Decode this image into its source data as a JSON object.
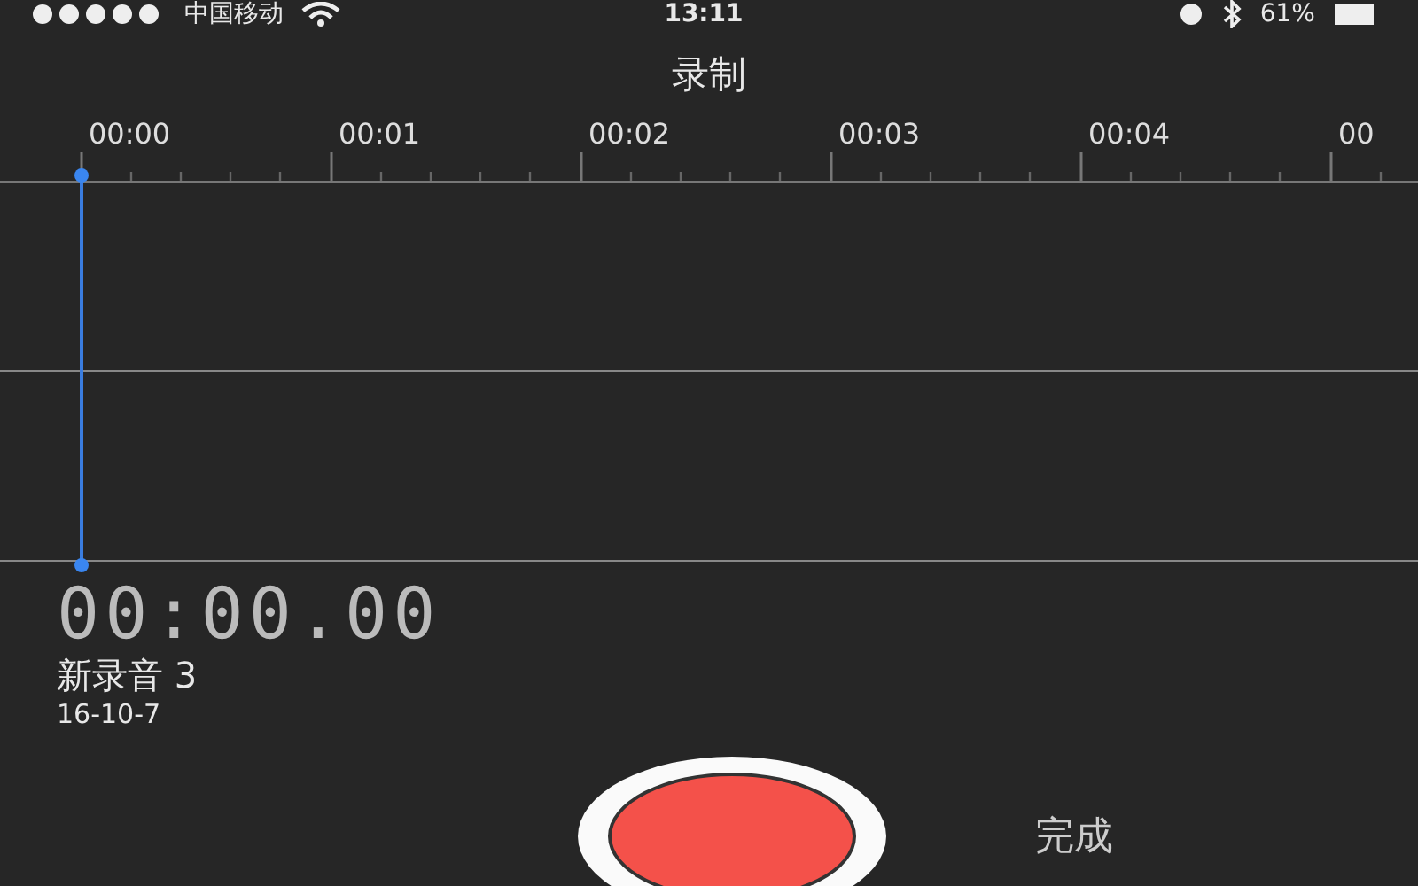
{
  "status_bar": {
    "carrier": "中国移动",
    "time": "13:11",
    "battery": "61%"
  },
  "title": "录制",
  "timeline": {
    "tick_labels": [
      "00:00",
      "00:01",
      "00:02",
      "00:03",
      "00:04",
      "00"
    ]
  },
  "recording": {
    "elapsed": "00:00.00",
    "name": "新录音 3",
    "date": "16-10-7"
  },
  "done_button": "完成"
}
